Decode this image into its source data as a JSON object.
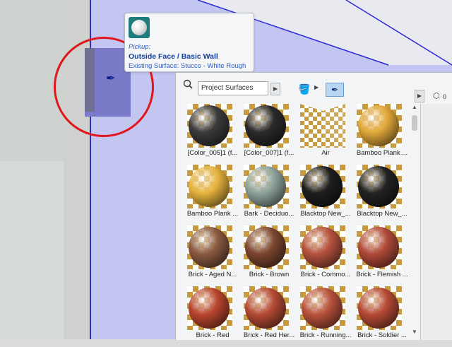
{
  "tooltip": {
    "label": "Pickup:",
    "title": "Outside Face / Basic Wall",
    "subtitle": "Existing Surface: Stucco - White Rough"
  },
  "panel": {
    "search_placeholder": "Project Surfaces",
    "cube_count": "0",
    "icons": {
      "search": "search-icon",
      "bucket": "paint-bucket-icon",
      "eyedropper": "eyedropper-icon",
      "cube": "cube-icon"
    },
    "surfaces": [
      {
        "label": "[Color_005]1 (f...",
        "color": "#3a3a3a"
      },
      {
        "label": "[Color_007]1 (f...",
        "color": "#2a2a2a"
      },
      {
        "label": "Air",
        "color": ""
      },
      {
        "label": "Bamboo Plank ...",
        "color": "#e2a93a"
      },
      {
        "label": "Bamboo Plank ...",
        "color": "#e6b43e"
      },
      {
        "label": "Bark - Deciduo...",
        "color": "#8fa39b"
      },
      {
        "label": "Blacktop New_...",
        "color": "#1e1e1e"
      },
      {
        "label": "Blacktop New_...",
        "color": "#222222"
      },
      {
        "label": "Brick - Aged N...",
        "color": "#8a5a40"
      },
      {
        "label": "Brick - Brown",
        "color": "#7b4630"
      },
      {
        "label": "Brick - Commo...",
        "color": "#b5523e"
      },
      {
        "label": "Brick - Flemish ...",
        "color": "#b04a3a"
      },
      {
        "label": "Brick - Red",
        "color": "#b8452e"
      },
      {
        "label": "Brick - Red Her...",
        "color": "#b34a34"
      },
      {
        "label": "Brick - Running...",
        "color": "#b8513c"
      },
      {
        "label": "Brick - Soldier ...",
        "color": "#b54a36"
      }
    ]
  }
}
